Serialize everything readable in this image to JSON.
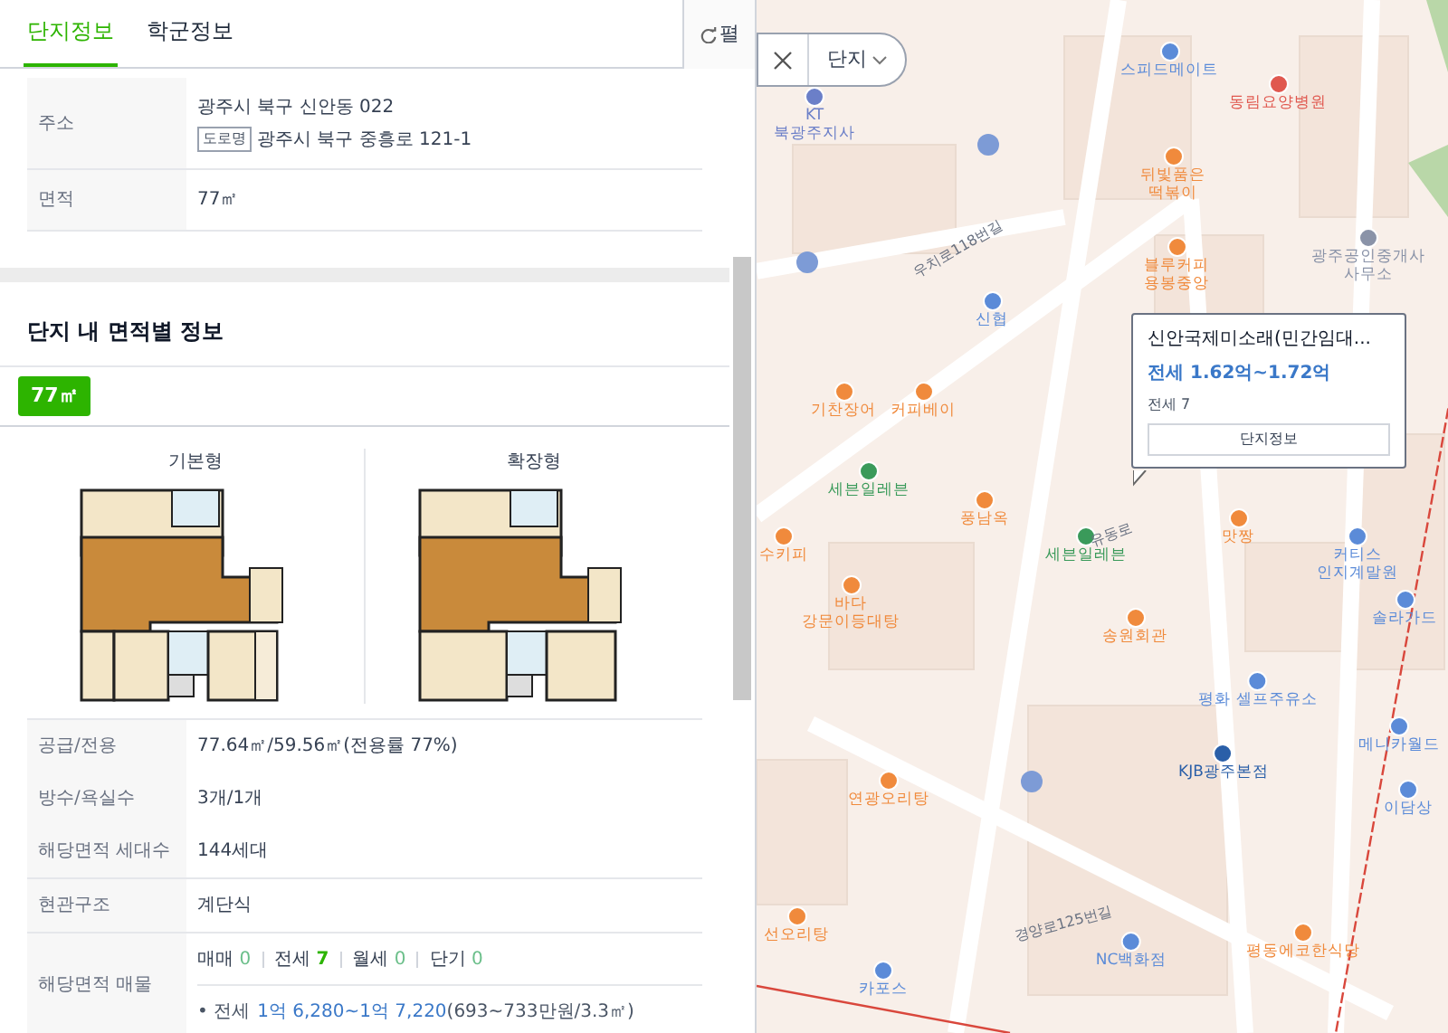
{
  "tabs": [
    {
      "label": "단지정보",
      "selected": true
    },
    {
      "label": "학군정보",
      "selected": false
    }
  ],
  "toggle_button": {
    "label": "펼"
  },
  "basic_info": [
    {
      "label": "주소",
      "lines": [
        {
          "text": "광주시 북구 신안동 022"
        },
        {
          "badge": "도로명",
          "text": "광주시 북구 중흥로 121-1"
        }
      ]
    },
    {
      "label": "면적",
      "lines": [
        {
          "text": "77㎡"
        }
      ]
    }
  ],
  "area_section": {
    "title": "단지 내 면적별 정보",
    "area_tabs": [
      {
        "label": "77㎡",
        "selected": true
      }
    ],
    "plans": [
      {
        "label": "기본형",
        "kind": "basic"
      },
      {
        "label": "확장형",
        "kind": "extended"
      }
    ],
    "rows": [
      {
        "label": "공급/전용",
        "value": "77.64㎡/59.56㎡(전용률 77%)"
      },
      {
        "label": "방수/욕실수",
        "value": "3개/1개"
      },
      {
        "label": "해당면적 세대수",
        "value": "144세대"
      },
      {
        "label": "현관구조",
        "value": "계단식",
        "divider": true
      },
      {
        "label": "해당면적 매물",
        "counts": [
          {
            "label": "매매",
            "value": "0",
            "has_listings": false
          },
          {
            "label": "전세",
            "value": "7",
            "has_listings": true
          },
          {
            "label": "월세",
            "value": "0",
            "has_listings": false
          },
          {
            "label": "단기",
            "value": "0",
            "has_listings": false
          }
        ],
        "detail": {
          "prefix": "• 전세",
          "range": "1억 6,280~1억 7,220",
          "suffix": "(693~733만원/3.3㎡)"
        }
      }
    ]
  },
  "map": {
    "filter": {
      "label": "단지"
    },
    "popup": {
      "title": "신안국제미소래(민간임대...",
      "price": "전세 1.62억~1.72억",
      "count": "전세 7",
      "button": "단지정보"
    },
    "labels": [
      {
        "text": "스피드메이트",
        "kind": "poi",
        "color": "#5b8bd8"
      },
      {
        "text": "동림요양병원",
        "kind": "poi",
        "color": "#e0584f"
      },
      {
        "text": "KT\n북광주지사",
        "kind": "poi",
        "color": "#6b7fc8"
      },
      {
        "text": "뒤빛품은\n떡볶이",
        "kind": "poi",
        "color": "#f08a3c"
      },
      {
        "text": "블루커피\n용봉중앙",
        "kind": "poi",
        "color": "#f08a3c"
      },
      {
        "text": "광주공인중개사\n사무소",
        "kind": "poi",
        "color": "#8a93a8"
      },
      {
        "text": "신협",
        "kind": "poi",
        "color": "#5b8bd8"
      },
      {
        "text": "기찬장어",
        "kind": "poi",
        "color": "#f08a3c"
      },
      {
        "text": "커피베이",
        "kind": "poi",
        "color": "#f08a3c"
      },
      {
        "text": "세븐일레븐",
        "kind": "poi",
        "color": "#3a9a5a"
      },
      {
        "text": "풍남옥",
        "kind": "poi",
        "color": "#f08a3c"
      },
      {
        "text": "수키피",
        "kind": "poi",
        "color": "#f08a3c"
      },
      {
        "text": "바다\n강문이등대탕",
        "kind": "poi",
        "color": "#f08a3c"
      },
      {
        "text": "세븐일레븐",
        "kind": "poi",
        "color": "#3a9a5a"
      },
      {
        "text": "맛짱",
        "kind": "poi",
        "color": "#f08a3c"
      },
      {
        "text": "커티스\n인지계말원",
        "kind": "poi",
        "color": "#5b8bd8"
      },
      {
        "text": "송원회관",
        "kind": "poi",
        "color": "#f08a3c"
      },
      {
        "text": "솔라가드",
        "kind": "poi",
        "color": "#5b8bd8"
      },
      {
        "text": "평화 셀프주유소",
        "kind": "poi",
        "color": "#5b8bd8"
      },
      {
        "text": "메니카월드",
        "kind": "poi",
        "color": "#5b8bd8"
      },
      {
        "text": "KJB광주본점",
        "kind": "poi",
        "color": "#2a5fa8"
      },
      {
        "text": "이담상",
        "kind": "poi",
        "color": "#5b8bd8"
      },
      {
        "text": "연광오리탕",
        "kind": "poi",
        "color": "#f08a3c"
      },
      {
        "text": "NC백화점",
        "kind": "poi",
        "color": "#5b8bd8"
      },
      {
        "text": "평동에코한식당",
        "kind": "poi",
        "color": "#f08a3c"
      },
      {
        "text": "카포스",
        "kind": "poi",
        "color": "#5b8bd8"
      },
      {
        "text": "선오리탕",
        "kind": "poi",
        "color": "#f08a3c"
      },
      {
        "text": "우치로118번길",
        "kind": "road"
      },
      {
        "text": "경양로125번길",
        "kind": "road"
      },
      {
        "text": "유동로",
        "kind": "road"
      }
    ]
  }
}
